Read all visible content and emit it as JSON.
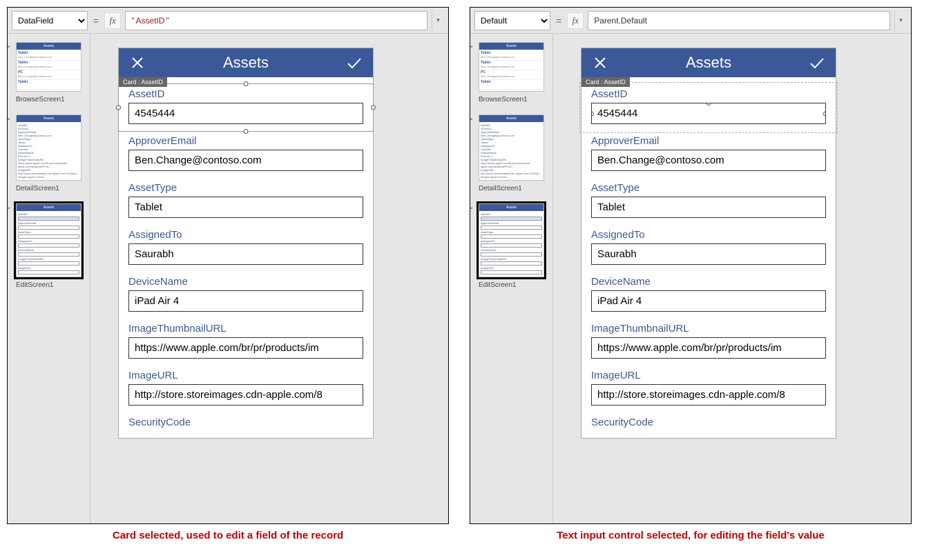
{
  "left": {
    "property": "DataField",
    "formula": "\"AssetID\"",
    "formula_is_string": true,
    "caption": "Card selected, used to edit a field of the record",
    "card_tag": "Card : AssetID",
    "selected": "card"
  },
  "right": {
    "property": "Default",
    "formula": "Parent.Default",
    "formula_is_string": false,
    "caption": "Text input control selected, for editing the field's value",
    "card_tag": "Card : AssetID",
    "selected": "input"
  },
  "thumbs": [
    {
      "label": "BrowseScreen1"
    },
    {
      "label": "DetailScreen1"
    },
    {
      "label": "EditScreen1"
    }
  ],
  "phone": {
    "title": "Assets"
  },
  "fields": [
    {
      "label": "AssetID",
      "value": "4545444"
    },
    {
      "label": "ApproverEmail",
      "value": "Ben.Change@contoso.com"
    },
    {
      "label": "AssetType",
      "value": "Tablet"
    },
    {
      "label": "AssignedTo",
      "value": "Saurabh"
    },
    {
      "label": "DeviceName",
      "value": "iPad Air 4"
    },
    {
      "label": "ImageThumbnailURL",
      "value": "https://www.apple.com/br/pr/products/im"
    },
    {
      "label": "ImageURL",
      "value": "http://store.storeimages.cdn-apple.com/8"
    },
    {
      "label": "SecurityCode",
      "value": ""
    }
  ]
}
